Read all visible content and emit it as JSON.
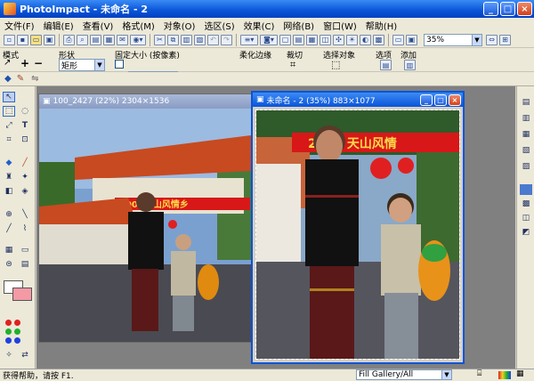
{
  "app": {
    "title": "PhotoImpact - 未命名 - 2",
    "window_buttons": [
      "_",
      "□",
      "×"
    ]
  },
  "menu": [
    "文件(F)",
    "编辑(E)",
    "查看(V)",
    "格式(M)",
    "对象(O)",
    "选区(S)",
    "效果(C)",
    "网络(B)",
    "窗口(W)",
    "帮助(H)"
  ],
  "toolbar": {
    "zoom_value": "35%"
  },
  "attributes": {
    "mode_label": "模式",
    "shape_label": "形状",
    "shape_value": "矩形",
    "fixed_size_label": "固定大小 (按像素)",
    "width_value": "100",
    "height_value": "100",
    "soft_edge_label": "柔化边缘",
    "soft_edge_value": "0",
    "crop_label": "裁切",
    "select_object_label": "选择对象",
    "options_label": "选项",
    "add_label": "添加",
    "mode_symbols": [
      "↗",
      "+",
      "−"
    ]
  },
  "windows": {
    "background": {
      "title": "100_2427 (22%) 2304×1536",
      "banner_text": "2004天山风情乡"
    },
    "active": {
      "title": "未命名 - 2 (35%) 883×1077",
      "banner_text": "2004 天山风情"
    }
  },
  "status": {
    "help_text": "获得帮助，请按 F1.",
    "gallery_value": "Fill Gallery/All"
  }
}
